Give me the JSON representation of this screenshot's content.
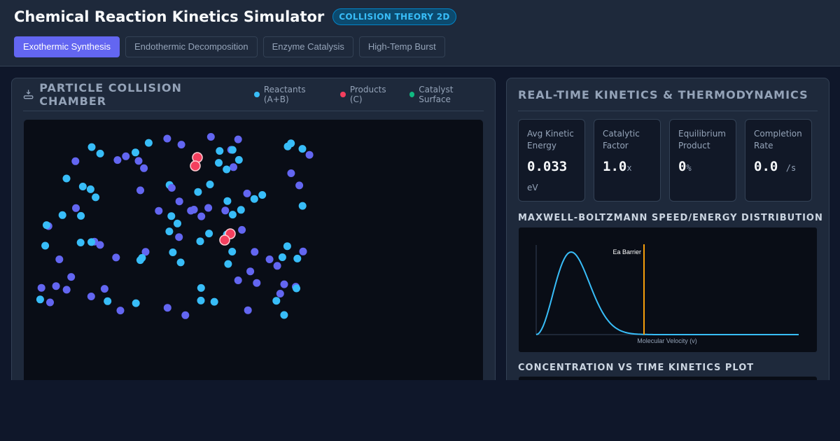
{
  "app": {
    "title": "Chemical Reaction Kinetics Simulator",
    "badge": "COLLISION THEORY 2D"
  },
  "tabs": [
    {
      "label": "Exothermic Synthesis",
      "active": true
    },
    {
      "label": "Endothermic Decomposition",
      "active": false
    },
    {
      "label": "Enzyme Catalysis",
      "active": false
    },
    {
      "label": "High-Temp Burst",
      "active": false
    }
  ],
  "chamber": {
    "title": "PARTICLE COLLISION CHAMBER",
    "icon": "flask-icon",
    "legend": [
      {
        "label": "Reactants (A+B)",
        "color": "#38bdf8"
      },
      {
        "label": "Products (C)",
        "color": "#f43f5e"
      },
      {
        "label": "Catalyst Surface",
        "color": "#10b981"
      }
    ],
    "colors": {
      "reactant_a": "#38bdf8",
      "reactant_b": "#6366f1",
      "product": "#f43f5e",
      "background": "#090d16"
    }
  },
  "kinetics": {
    "title": "REAL-TIME KINETICS & THERMODYNAMICS",
    "stats": [
      {
        "label": "Avg Kinetic Energy",
        "value": "0.033",
        "unit": "eV"
      },
      {
        "label": "Catalytic Factor",
        "value": "1.0",
        "unit": "x"
      },
      {
        "label": "Equilibrium Product",
        "value": "0",
        "unit": "%"
      },
      {
        "label": "Completion Rate",
        "value": "0.0",
        "unit": "/s"
      }
    ],
    "distribution_title": "MAXWELL-BOLTZMANN SPEED/ENERGY DISTRIBUTION",
    "distribution": {
      "barrier_label": "Ea Barrier",
      "x_label": "Molecular Velocity (v)",
      "curve_color": "#38bdf8",
      "barrier_color": "#f59e0b"
    },
    "concentration_title": "CONCENTRATION VS TIME KINETICS PLOT"
  }
}
